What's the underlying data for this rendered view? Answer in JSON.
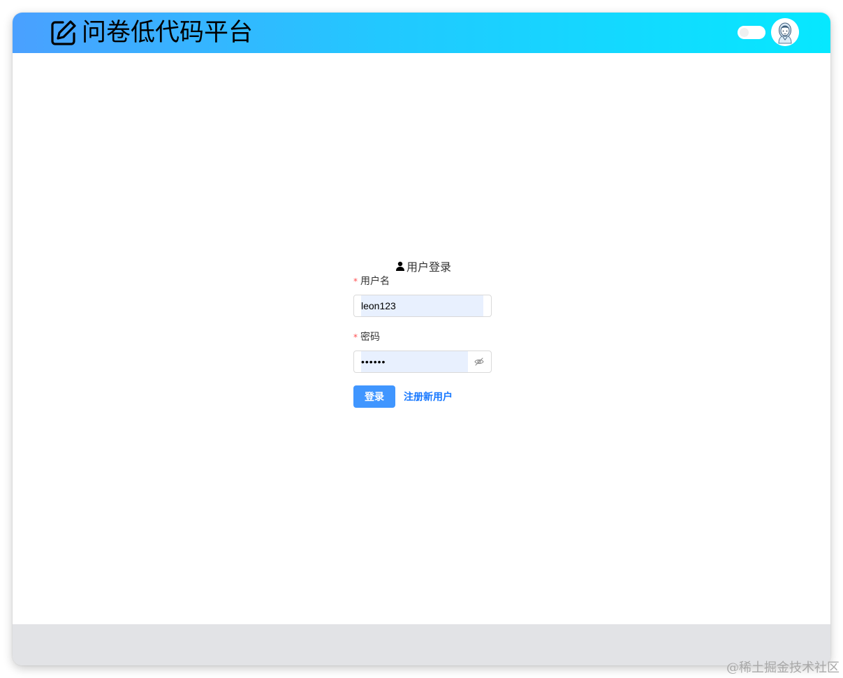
{
  "header": {
    "logo_text": "问卷低代码平台",
    "logo_icon": "edit-icon",
    "theme_toggle_icon": "toggle-switch",
    "avatar_icon": "user-avatar",
    "gradient_start": "#4aa0ff",
    "gradient_end": "#06e8ff"
  },
  "login": {
    "title": "用户登录",
    "title_icon": "user-icon",
    "username": {
      "required_mark": "*",
      "label": "用户名",
      "value": "leon123"
    },
    "password": {
      "required_mark": "*",
      "label": "密码",
      "value": "••••••",
      "toggle_icon": "eye-invisible-icon"
    },
    "submit_label": "登录",
    "register_label": "注册新用户",
    "primary_color": "#4096ff"
  },
  "footer": {
    "background": "#e2e3e6"
  },
  "watermark": "@稀土掘金技术社区"
}
